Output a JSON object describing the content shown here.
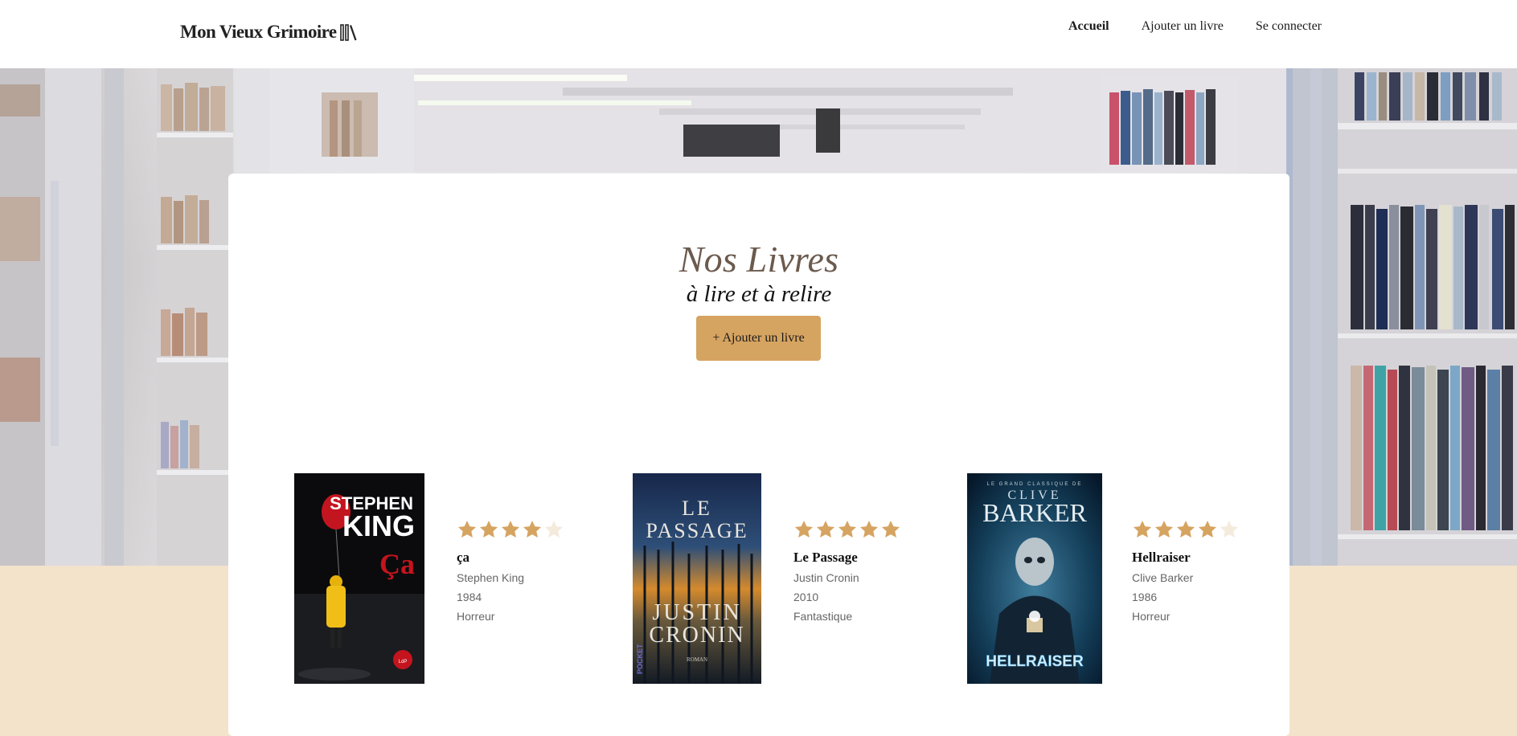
{
  "header": {
    "logo": "Mon Vieux Grimoire",
    "nav": [
      {
        "label": "Accueil",
        "active": true
      },
      {
        "label": "Ajouter un livre",
        "active": false
      },
      {
        "label": "Se connecter",
        "active": false
      }
    ]
  },
  "main": {
    "title": "Nos Livres",
    "subtitle": "à lire et à relire",
    "add_button": "+ Ajouter un livre"
  },
  "books": [
    {
      "title": "ça",
      "author": "Stephen King",
      "year": "1984",
      "genre": "Horreur",
      "rating": 4,
      "cover": {
        "author_line1": "STEPHEN",
        "author_line2": "KING",
        "title": "Ça",
        "publisher": "Le Livre de Poche"
      }
    },
    {
      "title": "Le Passage",
      "author": "Justin Cronin",
      "year": "2010",
      "genre": "Fantastique",
      "rating": 5,
      "cover": {
        "title_line1": "LE",
        "title_line2": "PASSAGE",
        "author_line1": "JUSTIN",
        "author_line2": "CRONIN",
        "series": "POCKET",
        "label": "ROMAN"
      }
    },
    {
      "title": "Hellraiser",
      "author": "Clive Barker",
      "year": "1986",
      "genre": "Horreur",
      "rating": 4,
      "cover": {
        "author_line1": "CLIVE",
        "author_line2": "BARKER",
        "title": "HELLRAISER"
      }
    }
  ],
  "colors": {
    "accent": "#d6a461",
    "star_filled": "#d6a461",
    "star_empty": "#f4ebdd",
    "page_bg": "#f3e3cb",
    "title_color": "#6b5a4e"
  },
  "icons": [
    "books-icon",
    "star-icon"
  ]
}
